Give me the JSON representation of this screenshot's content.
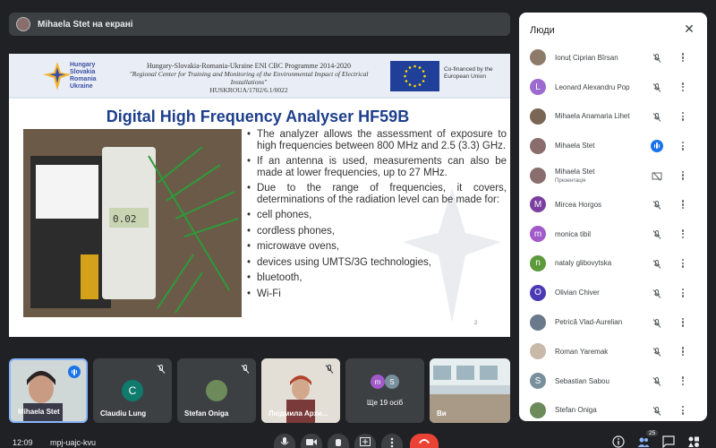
{
  "presenter_bar": {
    "label": "Mihaela Stet на екрані"
  },
  "slide": {
    "header": {
      "logo_lines": [
        "Hungary",
        "Slovakia",
        "Romania",
        "Ukraine"
      ],
      "programme": "Hungary-Slovakia-Romania-Ukraine ENI CBC Programme 2014-2020",
      "project": "\"Regional Center for Training and Monitoring of the Environmental Impact of Electrical Installations\"",
      "code": "HUSKROUA/1702/6.1/0022",
      "cofinanced": "Co-financed by the European Union"
    },
    "title": "Digital High Frequency Analyser HF59B",
    "bullets": [
      "The analyzer allows the assessment of exposure to high frequencies between 800 MHz and 2.5 (3.3) GHz.",
      "If an antenna is used, measurements can also be made at lower frequencies, up to 27 MHz.",
      "Due to the range of frequencies, it covers, determinations of the radiation level can be made for:",
      "cell phones,",
      "cordless phones,",
      "microwave ovens,",
      "devices using UMTS/3G technologies,",
      "bluetooth,",
      "Wi-Fi"
    ],
    "page_number": "2"
  },
  "people_panel": {
    "title": "Люди",
    "people": [
      {
        "name": "Ionuț Ciprian Bîrsan",
        "initial": "",
        "color": "#8d7b6a",
        "photo": true,
        "mic": "muted"
      },
      {
        "name": "Leonard Alexandru Pop",
        "initial": "L",
        "color": "#9c6bcf",
        "photo": false,
        "mic": "muted"
      },
      {
        "name": "Mihaela Anamaria Lihet",
        "initial": "",
        "color": "#7a6654",
        "photo": true,
        "mic": "muted"
      },
      {
        "name": "Mihaela Stet",
        "initial": "",
        "color": "#8a6d6d",
        "photo": true,
        "mic": "speaking"
      },
      {
        "name": "Mihaela Stet",
        "sub": "Презентація",
        "initial": "",
        "color": "#8a6d6d",
        "photo": true,
        "mic": "present"
      },
      {
        "name": "Mircea Horgos",
        "initial": "M",
        "color": "#7b3fa0",
        "photo": false,
        "mic": "muted"
      },
      {
        "name": "monica tibil",
        "initial": "m",
        "color": "#a259c9",
        "photo": false,
        "mic": "muted"
      },
      {
        "name": "nataly glibovytska",
        "initial": "n",
        "color": "#5d9a3b",
        "photo": false,
        "mic": "muted"
      },
      {
        "name": "Olivian Chiver",
        "initial": "O",
        "color": "#4a3ab5",
        "photo": false,
        "mic": "muted"
      },
      {
        "name": "Petrică Vlad-Aurelian",
        "initial": "",
        "color": "#6b7a8a",
        "photo": true,
        "mic": "muted"
      },
      {
        "name": "Roman Yaremak",
        "initial": "",
        "color": "#c8b9a8",
        "photo": true,
        "mic": "muted"
      },
      {
        "name": "Sebastian Sabou",
        "initial": "S",
        "color": "#78909c",
        "photo": false,
        "mic": "muted"
      },
      {
        "name": "Stefan Oniga",
        "initial": "",
        "color": "#6c8a5a",
        "photo": true,
        "mic": "muted"
      }
    ]
  },
  "tiles": [
    {
      "label": "Mihaela Stet",
      "kind": "video"
    },
    {
      "label": "Claudiu Lung",
      "initial": "C",
      "kind": "avatar"
    },
    {
      "label": "Stefan Oniga",
      "kind": "avatar-photo"
    },
    {
      "label": "Людмила Архи...",
      "kind": "video"
    },
    {
      "label": "Ще 19 осіб",
      "initials": [
        "m",
        "S"
      ],
      "kind": "more"
    },
    {
      "label": "Ви",
      "kind": "video"
    }
  ],
  "bottom_bar": {
    "time": "12:09",
    "code": "mpj-uajc-kvu",
    "people_count": "25"
  }
}
